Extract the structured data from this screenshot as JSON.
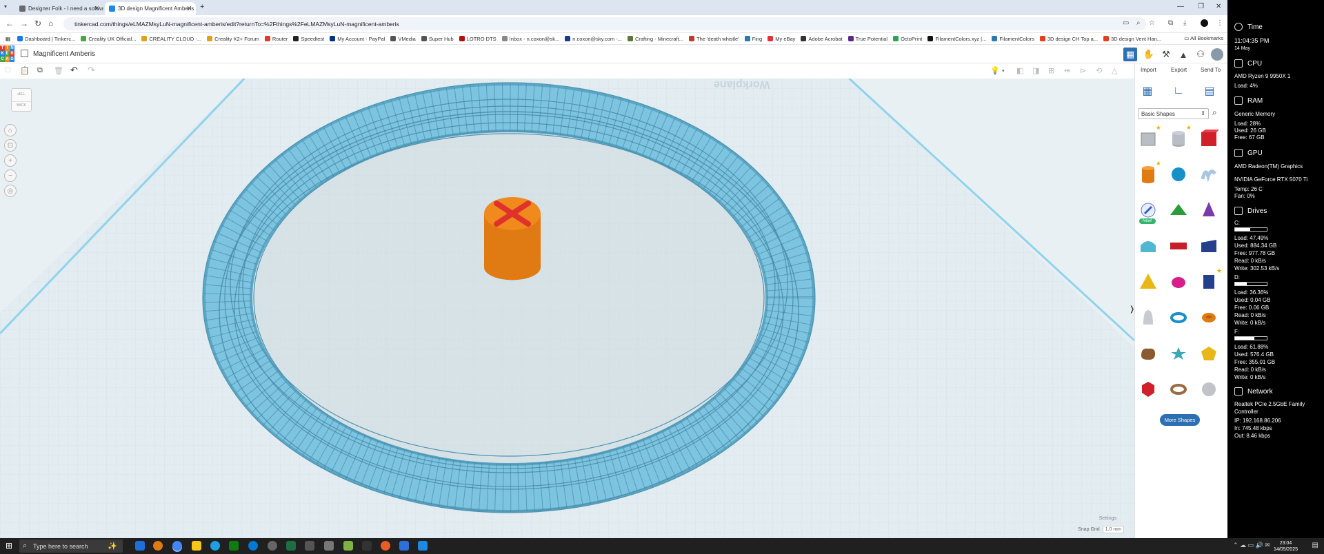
{
  "browser": {
    "tabs": [
      {
        "title": "Designer Folk - I need a softwa...",
        "active": false
      },
      {
        "title": "3D design Magnificent Amberis",
        "active": true
      }
    ],
    "url": "tinkercad.com/things/eLMAZMsyLuN-magnificent-amberis/edit?returnTo=%2Fthings%2FeLMAZMsyLuN-magnificent-amberis",
    "bookmarks": [
      {
        "label": "Dashboard | Tinkerc...",
        "color": "#1877f2"
      },
      {
        "label": "Creality UK Official...",
        "color": "#46a640"
      },
      {
        "label": "CREALITY CLOUD -...",
        "color": "#e0a020"
      },
      {
        "label": "Creality K2+ Forum",
        "color": "#e0a020"
      },
      {
        "label": "Router",
        "color": "#e23b2e"
      },
      {
        "label": "Speedtest",
        "color": "#222222"
      },
      {
        "label": "My Account - PayPal",
        "color": "#003087"
      },
      {
        "label": "VMedia",
        "color": "#555555"
      },
      {
        "label": "Super Hub",
        "color": "#555555"
      },
      {
        "label": "LOTRO DTS",
        "color": "#b01010"
      },
      {
        "label": "Inbox - n.coxon@sk...",
        "color": "#888888"
      },
      {
        "label": "n.coxon@sky.com -...",
        "color": "#1a3a8a"
      },
      {
        "label": "Crafting - Minecraft...",
        "color": "#5a7a3a"
      },
      {
        "label": "The 'death whistle'",
        "color": "#c0392b"
      },
      {
        "label": "Fing",
        "color": "#2a7ab0"
      },
      {
        "label": "My eBay",
        "color": "#e53238"
      },
      {
        "label": "Adobe Acrobat",
        "color": "#333333"
      },
      {
        "label": "True Potential",
        "color": "#5b2a86"
      },
      {
        "label": "OctoPrint",
        "color": "#2ea44f"
      },
      {
        "label": "FilamentColors.xyz |...",
        "color": "#111111"
      },
      {
        "label": "FilamentColors",
        "color": "#2a7ab0"
      },
      {
        "label": "3D design CH Top a...",
        "color": "#e0401a"
      },
      {
        "label": "3D design Vent Han...",
        "color": "#e0401a"
      }
    ],
    "all_bookmarks": "All Bookmarks"
  },
  "tinkercad": {
    "title": "Magnificent Amberis",
    "viewcube": {
      "top": "sELL",
      "front": "BACK"
    },
    "panel_tabs": [
      "Import",
      "Export",
      "Send To"
    ],
    "shape_category": "Basic Shapes",
    "new_badge": "New!",
    "more_shapes": "More Shapes",
    "settings": "Settings",
    "snap_grid_label": "Snap Grid",
    "snap_grid_value": "1.0 mm",
    "workplane_label": "Workplane",
    "colors": {
      "ring": "#7cc4e0",
      "ring_dark": "#5aa6c5",
      "cylinder": "#f08a1c",
      "hole_x": "#e0322c",
      "accent": "#2d6fb3"
    }
  },
  "sidebar": {
    "time_title": "Time",
    "time": "11:04:35 PM",
    "date": "14 May",
    "cpu_title": "CPU",
    "cpu_name": "AMD Ryzen 9 9950X 1",
    "cpu_load": "Load: 4%",
    "ram_title": "RAM",
    "ram_name": "Generic Memory",
    "ram_load": "Load: 28%",
    "ram_used": "Used: 26 GB",
    "ram_free": "Free: 67 GB",
    "gpu_title": "GPU",
    "gpu_name1": "AMD Radeon(TM) Graphics",
    "gpu_name2": "NVIDIA GeForce RTX 5070 Ti",
    "gpu_temp": "Temp: 26 C",
    "gpu_fan": "Fan: 0%",
    "drives_title": "Drives",
    "drives": [
      {
        "letter": "C:",
        "fill": 0.4749,
        "load": "Load: 47.49%",
        "used": "Used: 884.34 GB",
        "free": "Free: 977.78 GB",
        "read": "Read: 0 kB/s",
        "write": "Write: 302.53 kB/s"
      },
      {
        "letter": "D:",
        "fill": 0.3636,
        "load": "Load: 36.36%",
        "used": "Used: 0.04 GB",
        "free": "Free: 0.06 GB",
        "read": "Read: 0 kB/s",
        "write": "Write: 0 kB/s"
      },
      {
        "letter": "F:",
        "fill": 0.6188,
        "load": "Load: 61.88%",
        "used": "Used: 576.4 GB",
        "free": "Free: 355.01 GB",
        "read": "Read: 0 kB/s",
        "write": "Write: 0 kB/s"
      }
    ],
    "network_title": "Network",
    "network_name1": "Realtek PCIe 2.5GbE Family",
    "network_name2": "Controller",
    "network_ip": "IP: 192.168.86.206",
    "network_in": "In: 745.48 kbps",
    "network_out": "Out: 8.46 kbps"
  },
  "taskbar": {
    "search_placeholder": "Type here to search",
    "time": "23:04",
    "date": "14/05/2025"
  }
}
